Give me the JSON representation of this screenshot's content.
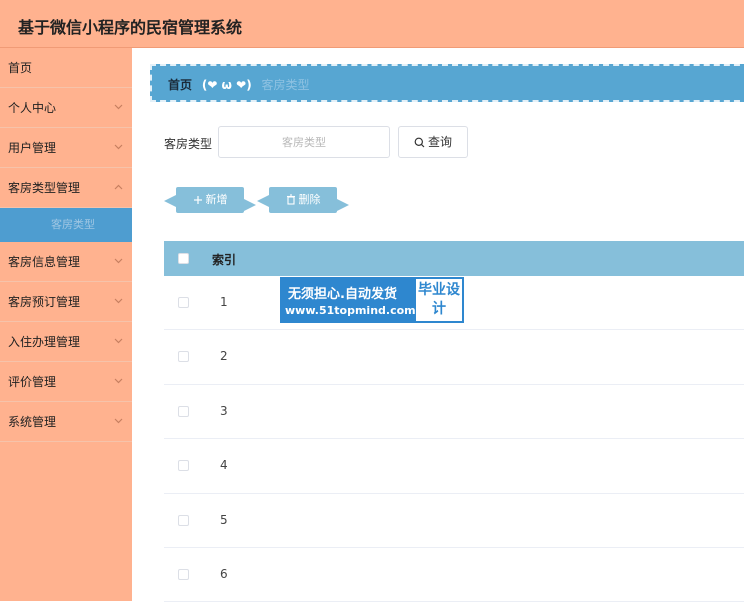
{
  "app": {
    "title": "基于微信小程序的民宿管理系统"
  },
  "sidebar": {
    "items": [
      {
        "label": "首页"
      },
      {
        "label": "个人中心"
      },
      {
        "label": "用户管理"
      },
      {
        "label": "客房类型管理"
      },
      {
        "label": "客房信息管理"
      },
      {
        "label": "客房预订管理"
      },
      {
        "label": "入住办理管理"
      },
      {
        "label": "评价管理"
      },
      {
        "label": "系统管理"
      }
    ],
    "active_sub": {
      "label": "客房类型"
    }
  },
  "breadcrumb": {
    "home": "首页",
    "face": "(❤ ω ❤)",
    "current": "客房类型"
  },
  "search": {
    "label": "客房类型",
    "placeholder": "客房类型",
    "button": "查询"
  },
  "actions": {
    "add": "新增",
    "delete": "删除"
  },
  "table": {
    "header": "索引",
    "rows": [
      "1",
      "2",
      "3",
      "4",
      "5",
      "6"
    ]
  },
  "watermark": {
    "line1": "无须担心.自动发货",
    "line2": "www.51topmind.com",
    "side": "毕业设计"
  },
  "colors": {
    "header_bg": "#ffb28f",
    "accent_blue": "#57a6d2",
    "table_header": "#86bfda"
  }
}
